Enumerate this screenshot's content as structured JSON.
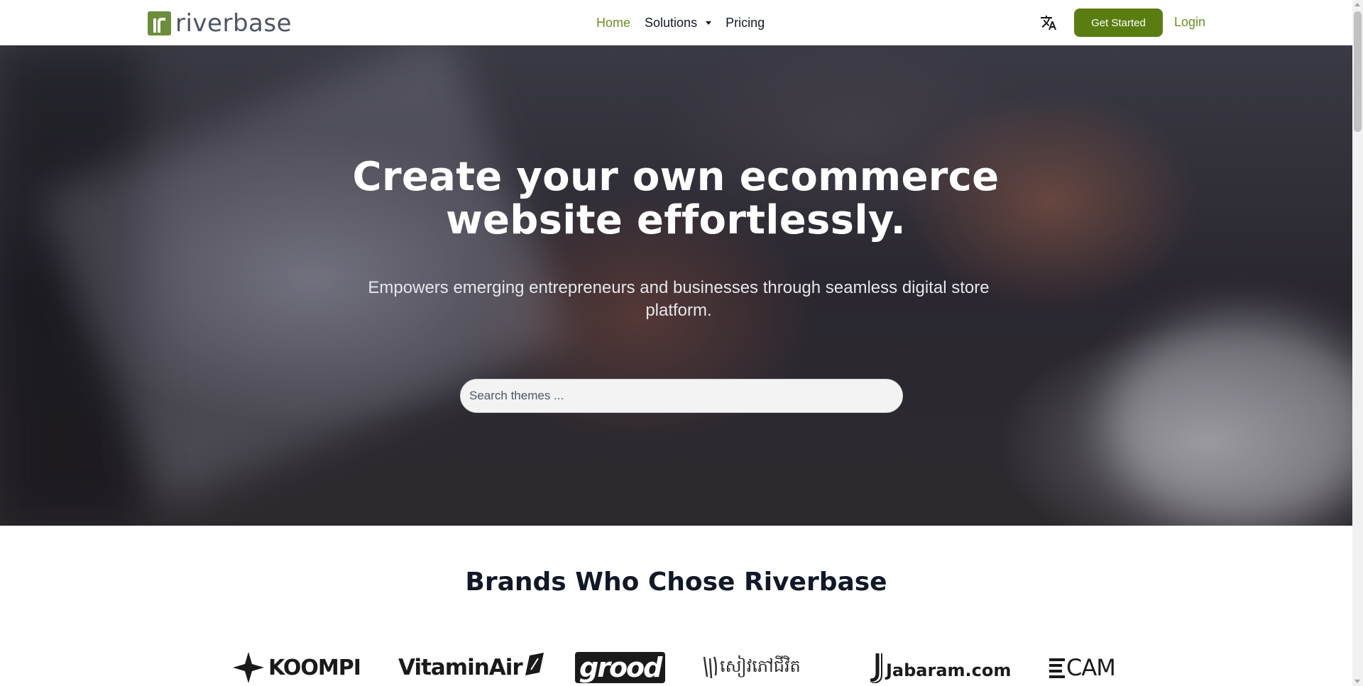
{
  "brand": {
    "name": "riverbase",
    "accent_color": "#5a7d12",
    "link_color": "#6b8e23"
  },
  "nav": {
    "items": [
      {
        "label": "Home",
        "active": true
      },
      {
        "label": "Solutions",
        "has_dropdown": true
      },
      {
        "label": "Pricing"
      }
    ],
    "translate_icon": "translate-icon",
    "get_started_label": "Get Started",
    "login_label": "Login"
  },
  "hero": {
    "title_line1": "Create your own ecommerce",
    "title_line2": "website effortlessly.",
    "subtitle": "Empowers emerging entrepreneurs and businesses through seamless digital store platform.",
    "search_placeholder": "Search themes ..."
  },
  "brands": {
    "title": "Brands Who Chose Riverbase",
    "logos": [
      {
        "name": "KOOMPI",
        "text": "KOOMPI"
      },
      {
        "name": "VitaminAir",
        "text": "VitaminAir"
      },
      {
        "name": "grood",
        "text": "grood"
      },
      {
        "name": "khmer-script-brand",
        "text": "សៀវភៅជីវិត"
      },
      {
        "name": "Jabaram",
        "text": "Jabaram.com"
      },
      {
        "name": "CAM",
        "text": "CAM"
      }
    ]
  }
}
